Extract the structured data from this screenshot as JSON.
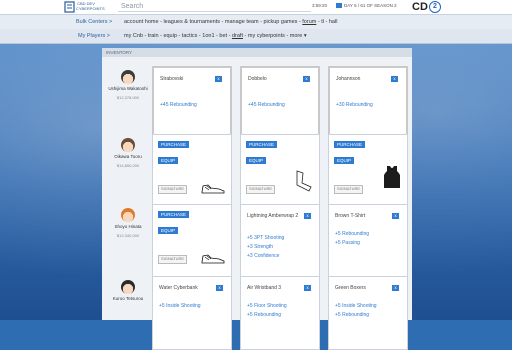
{
  "colors": {
    "accent": "#2f7bd1",
    "topbar": "#ffffff",
    "background": "#2e67ad"
  },
  "header": {
    "logo_line1": "CBD DEV",
    "logo_line2": "CYBERPOINTS",
    "search_placeholder": "Search",
    "stat1": "3:59:20",
    "day_label": "DAY 5 / 61 OF SEASON 2",
    "brand": "CD",
    "brand_circle": "2"
  },
  "nav": {
    "bulk_centers": "Bulk Centers  >",
    "my_players": "My Players  >",
    "row1": [
      "account home",
      "leagues & tournaments",
      "manage team",
      "pickup games",
      "forum",
      "tl",
      "hall"
    ],
    "row1_active": "forum",
    "row2": [
      "my Cnb",
      "train",
      "equip",
      "tactics",
      "1on1",
      "bet",
      "draft",
      "my cyberpoints",
      "more"
    ],
    "row2_active": "draft"
  },
  "panel_title": "INVENTORY",
  "players": [
    {
      "name": "Ushijima Wakatoshi",
      "salary": "$12,378,000"
    },
    {
      "name": "Oikawa Tooru",
      "salary": "$14,850,000"
    },
    {
      "name": "Shoyo Hinata",
      "salary": "$12,340,000"
    },
    {
      "name": "Kuroo Tetsurou",
      "salary": ""
    }
  ],
  "rows": [
    [
      {
        "title": "Strabovski",
        "bonuses": [
          "+45 Rebounding"
        ]
      },
      {
        "title": "Dobbelo",
        "bonuses": [
          "+45 Rebounding"
        ]
      },
      {
        "title": "Johannson",
        "bonuses": [
          "+30 Rebounding"
        ]
      }
    ],
    [
      {
        "purchase": "PURCHASE",
        "equip": "EQUIP",
        "signature": "SIGNATURE",
        "item": "shoe-icon"
      },
      {
        "purchase": "PURCHASE",
        "equip": "EQUIP",
        "signature": "SIGNATURE",
        "item": "arm-sleeve-icon"
      },
      {
        "purchase": "PURCHASE",
        "equip": "EQUIP",
        "signature": "SIGNATURE",
        "item": "jersey-icon"
      }
    ],
    [
      {
        "purchase": "PURCHASE",
        "equip": "EQUIP",
        "signature": "SIGNATURE",
        "item": "shoe-icon"
      },
      {
        "title": "Lightning Amberwrap 2",
        "bonuses": [
          "+5 3PT Shooting",
          "+3 Strength",
          "+3 Confidence"
        ]
      },
      {
        "title": "Brown T-Shirt",
        "bonuses": [
          "+5 Rebounding",
          "+5 Passing"
        ]
      }
    ],
    [
      {
        "title": "Water Cyberbank",
        "bonuses": [
          "+5 Inside Shooting"
        ]
      },
      {
        "title": "Air Wristband 3",
        "bonuses": [
          "+5 Floor Shooting",
          "+5 Rebounding"
        ]
      },
      {
        "title": "Green Boxers",
        "bonuses": [
          "+5 Inside Shooting",
          "+5 Rebounding"
        ]
      }
    ]
  ]
}
